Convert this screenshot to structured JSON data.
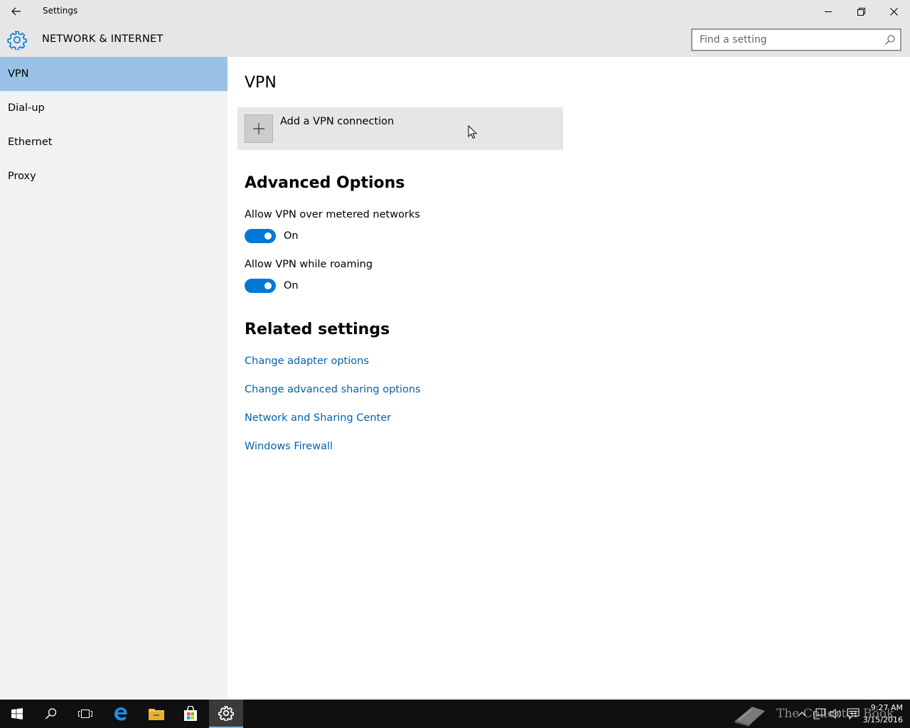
{
  "window": {
    "title": "Settings",
    "back_icon": "arrow-left-icon",
    "minimize_icon": "minimize-icon",
    "restore_icon": "restore-icon",
    "close_icon": "close-icon"
  },
  "header": {
    "section_title": "NETWORK & INTERNET",
    "section_icon": "gear-icon",
    "search_placeholder": "Find a setting"
  },
  "sidebar": {
    "items": [
      {
        "label": "VPN",
        "selected": true
      },
      {
        "label": "Dial-up",
        "selected": false
      },
      {
        "label": "Ethernet",
        "selected": false
      },
      {
        "label": "Proxy",
        "selected": false
      }
    ]
  },
  "main": {
    "vpn_heading": "VPN",
    "add_vpn_label": "Add a VPN connection",
    "advanced_heading": "Advanced Options",
    "options": [
      {
        "label": "Allow VPN over metered networks",
        "state": "On",
        "on": true
      },
      {
        "label": "Allow VPN while roaming",
        "state": "On",
        "on": true
      }
    ],
    "related_heading": "Related settings",
    "links": [
      "Change adapter options",
      "Change advanced sharing options",
      "Network and Sharing Center",
      "Windows Firewall"
    ]
  },
  "taskbar": {
    "time": "9:27 AM",
    "date": "3/15/2016",
    "watermark": "The Collector Book"
  },
  "colors": {
    "accent": "#0078d7",
    "link": "#0063b1",
    "selected_nav": "#99c2e6",
    "chrome": "#e6e6e6",
    "sidebar": "#f2f2f2"
  }
}
